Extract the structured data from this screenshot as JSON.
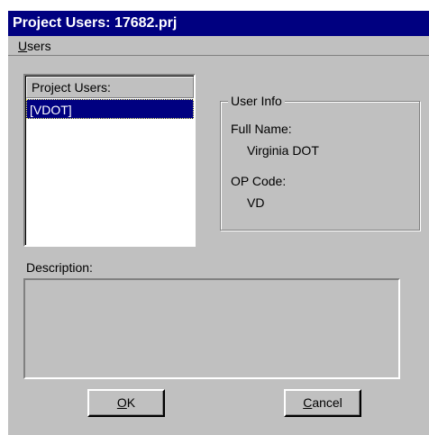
{
  "window": {
    "title": "Project Users: 17682.prj"
  },
  "menu": {
    "items": [
      {
        "label_underlined": "U",
        "label_rest": "sers"
      }
    ]
  },
  "users_list": {
    "header": "Project Users:",
    "items": [
      {
        "label": "[VDOT]",
        "selected": true
      }
    ]
  },
  "user_info": {
    "group_label": "User Info",
    "full_name_label": "Full Name:",
    "full_name_value": "Virginia DOT",
    "op_code_label": "OP Code:",
    "op_code_value": "VD"
  },
  "description": {
    "label": "Description:",
    "value": ""
  },
  "buttons": {
    "ok": {
      "underlined": "O",
      "rest": "K"
    },
    "cancel": {
      "underlined": "C",
      "rest": "ancel"
    }
  },
  "colors": {
    "title_bar": "#000080",
    "window_face": "#c0c0c0",
    "selection": "#000080"
  }
}
